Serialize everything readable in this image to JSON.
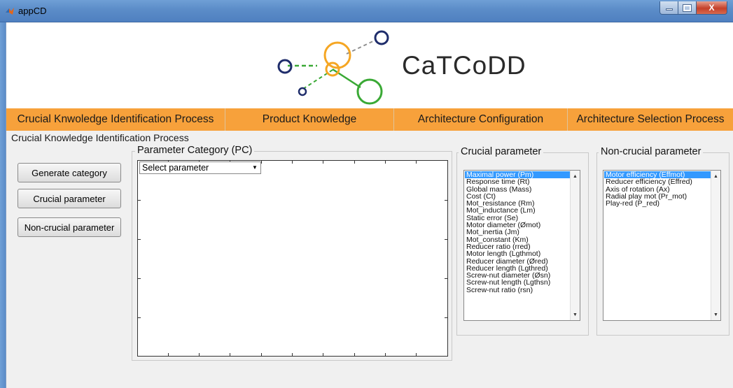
{
  "window": {
    "title": "appCD",
    "controls": {
      "minimize": "—",
      "maximize": "□",
      "close": "X"
    }
  },
  "header": {
    "logo_text": "CaTCoDD",
    "logo_colors": {
      "orange": "#f5a623",
      "green": "#3aa935",
      "navy": "#1f2d6b"
    }
  },
  "nav": {
    "items": [
      {
        "label": "Crucial Knwoledge Identification Process"
      },
      {
        "label": "Product Knowledge"
      },
      {
        "label": "Architecture Configuration"
      },
      {
        "label": "Architecture Selection Process"
      }
    ],
    "accent": "#f7a13b"
  },
  "section_title": "Crucial Knowledge Identification Process",
  "buttons": {
    "generate": "Generate category",
    "crucial": "Crucial parameter",
    "non_crucial": "Non-crucial parameter"
  },
  "parameter_category": {
    "label": "Parameter Category (PC)",
    "select_value": "Select parameter"
  },
  "crucial_panel": {
    "label": "Crucial parameter",
    "items": [
      "Maximal power (Pm)",
      "Response time (Rt)",
      "Global mass (Mass)",
      "Cost (Ct)",
      "Mot_resistance (Rm)",
      "Mot_inductance (Lm)",
      "Static error (Se)",
      "Motor diameter (Ømot)",
      "Mot_inertia (Jm)",
      "Mot_constant (Km)",
      "Reducer ratio (rred)",
      "Motor length (Lgthmot)",
      "Reducer diameter (Øred)",
      "Reducer length (Lgthred)",
      "Screw-nut diameter (Øsn)",
      "Screw-nut length (Lgthsn)",
      "Screw-nut ratio (rsn)"
    ],
    "selected_index": 0
  },
  "non_crucial_panel": {
    "label": "Non-crucial parameter",
    "items": [
      "Motor efficiency (Effmot)",
      "Reducer efficiency (Effred)",
      "Axis of rotation (Ax)",
      "Radial play mot (Pr_mot)",
      "Play-red (P_red)"
    ],
    "selected_index": 0
  },
  "scroll": {
    "up": "▲",
    "down": "▼"
  }
}
